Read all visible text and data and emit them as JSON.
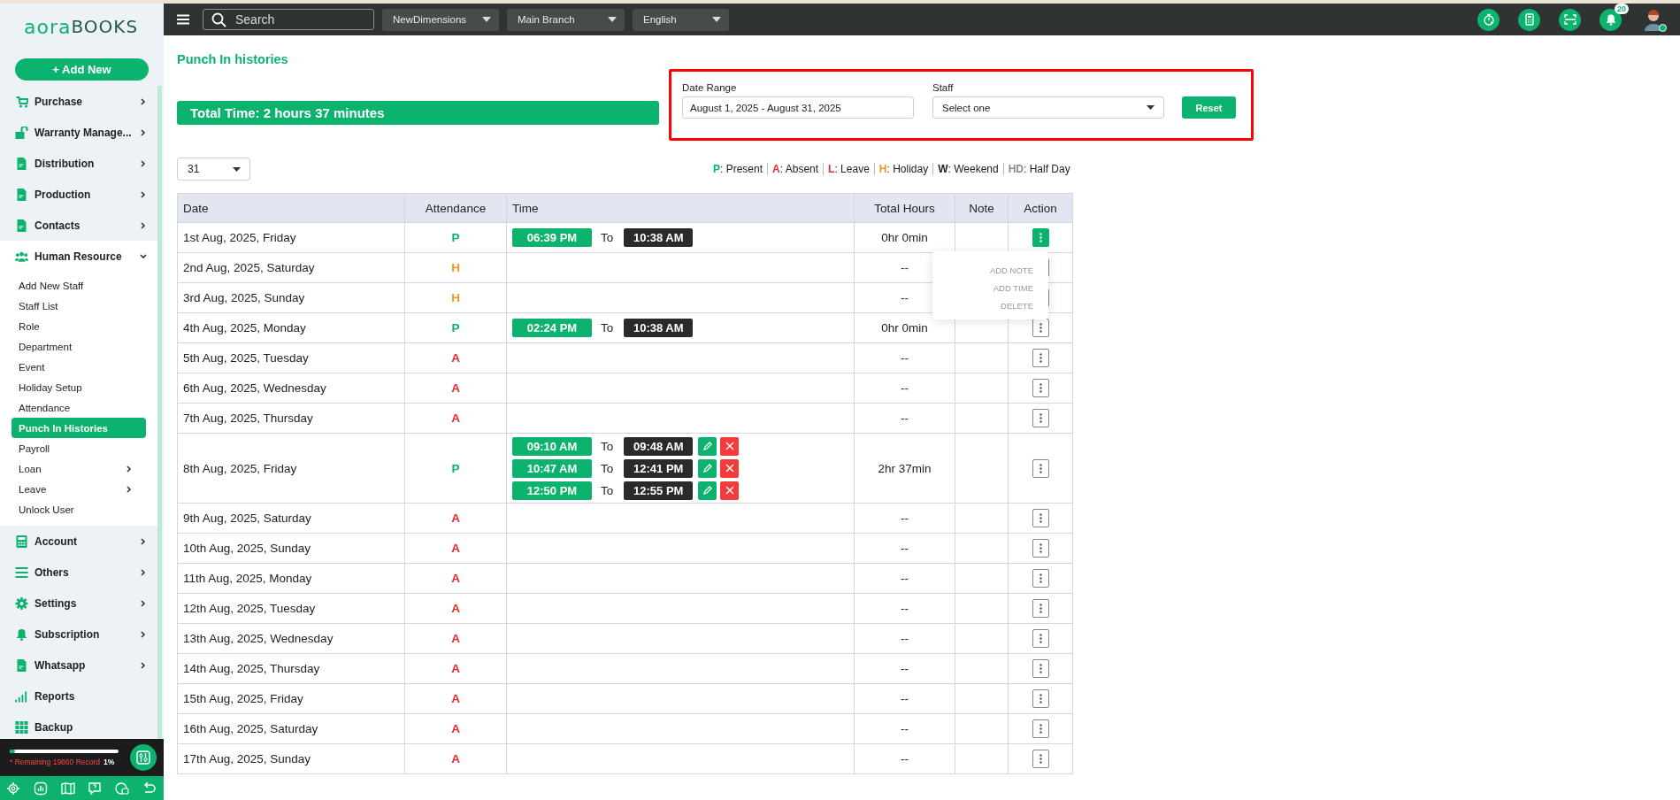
{
  "sidebar": {
    "logo": {
      "part_1": "aora",
      "part_2": "BOOKS"
    },
    "add_button": "+ Add New",
    "menu": [
      {
        "label": "Purchase",
        "kind": "group",
        "expanded": false
      },
      {
        "label": "Warranty Manage...",
        "kind": "group",
        "expanded": false
      },
      {
        "label": "Distribution",
        "kind": "group",
        "expanded": false
      },
      {
        "label": "Production",
        "kind": "group",
        "expanded": false
      },
      {
        "label": "Contacts",
        "kind": "group",
        "expanded": false
      },
      {
        "label": "Human Resource",
        "kind": "group",
        "expanded": true,
        "children": [
          {
            "label": "Add New Staff",
            "kind": "link",
            "selected": false
          },
          {
            "label": "Staff List",
            "kind": "link",
            "selected": false
          },
          {
            "label": "Role",
            "kind": "link",
            "selected": false
          },
          {
            "label": "Department",
            "kind": "link",
            "selected": false
          },
          {
            "label": "Event",
            "kind": "link",
            "selected": false
          },
          {
            "label": "Holiday Setup",
            "kind": "link",
            "selected": false
          },
          {
            "label": "Attendance",
            "kind": "link",
            "selected": false
          },
          {
            "label": "Punch In Histories",
            "kind": "link",
            "selected": true
          },
          {
            "label": "Payroll",
            "kind": "link",
            "selected": false
          },
          {
            "label": "Loan",
            "kind": "group",
            "selected": false
          },
          {
            "label": "Leave",
            "kind": "group",
            "selected": false
          },
          {
            "label": "Unlock User",
            "kind": "link",
            "selected": false
          }
        ]
      },
      {
        "label": "Account",
        "kind": "group",
        "expanded": false
      },
      {
        "label": "Others",
        "kind": "group",
        "expanded": false
      },
      {
        "label": "Settings",
        "kind": "group",
        "expanded": false
      },
      {
        "label": "Subscription",
        "kind": "group",
        "expanded": false
      },
      {
        "label": "Whatsapp",
        "kind": "group",
        "expanded": false
      },
      {
        "label": "Reports",
        "kind": "link"
      },
      {
        "label": "Backup",
        "kind": "link"
      }
    ],
    "usage": {
      "text": "* Remaining 19860 Record",
      "percent": "1%",
      "level": 0.05
    }
  },
  "topbar": {
    "search": {
      "placeholder": "Search"
    },
    "dropdowns": [
      "NewDimensions",
      "Main Branch",
      "English"
    ],
    "notification_count": "20"
  },
  "page": {
    "title": "Punch In histories",
    "total_time": "Total Time: 2 hours 37 minutes",
    "filters": {
      "date_range": {
        "label": "Date Range",
        "value": "August 1, 2025 - August 31, 2025"
      },
      "staff": {
        "label": "Staff",
        "placeholder": "Select one"
      },
      "reset": "Reset"
    },
    "page_size": "31",
    "legend": [
      {
        "code": "P",
        "label": ": Present",
        "color": "#0cb36f"
      },
      {
        "code": "A",
        "label": ": Absent",
        "color": "#f0282d"
      },
      {
        "code": "L",
        "label": ": Leave",
        "color": "#f0282d"
      },
      {
        "code": "H",
        "label": ": Holiday",
        "color": "#f5961e"
      },
      {
        "code": "W",
        "label": ": Weekend",
        "color": "#222222"
      },
      {
        "code": "HD",
        "label": ": Half Day",
        "color": "#8a8a8a"
      }
    ],
    "table": {
      "columns": [
        "Date",
        "Attendance",
        "Time",
        "Total Hours",
        "Note",
        "Action"
      ],
      "rows": [
        {
          "date": "1st Aug, 2025, Friday",
          "attendance": "P",
          "color": "#0cb36f",
          "punches": [
            {
              "in": "06:39 PM",
              "to": "To",
              "out": "10:38 AM",
              "editable": false
            }
          ],
          "total": "0hr 0min",
          "menu_open": true
        },
        {
          "date": "2nd Aug, 2025, Saturday",
          "attendance": "H",
          "color": "#f5961e",
          "punches": [],
          "total": "--",
          "menu_open": false
        },
        {
          "date": "3rd Aug, 2025, Sunday",
          "attendance": "H",
          "color": "#f5961e",
          "punches": [],
          "total": "--",
          "menu_open": false
        },
        {
          "date": "4th Aug, 2025, Monday",
          "attendance": "P",
          "color": "#0cb36f",
          "punches": [
            {
              "in": "02:24 PM",
              "to": "To",
              "out": "10:38 AM",
              "editable": false
            }
          ],
          "total": "0hr 0min",
          "menu_open": false
        },
        {
          "date": "5th Aug, 2025, Tuesday",
          "attendance": "A",
          "color": "#f0282d",
          "punches": [],
          "total": "--",
          "menu_open": false
        },
        {
          "date": "6th Aug, 2025, Wednesday",
          "attendance": "A",
          "color": "#f0282d",
          "punches": [],
          "total": "--",
          "menu_open": false
        },
        {
          "date": "7th Aug, 2025, Thursday",
          "attendance": "A",
          "color": "#f0282d",
          "punches": [],
          "total": "--",
          "menu_open": false
        },
        {
          "date": "8th Aug, 2025, Friday",
          "attendance": "P",
          "color": "#0cb36f",
          "punches": [
            {
              "in": "09:10 AM",
              "to": "To",
              "out": "09:48 AM",
              "editable": true
            },
            {
              "in": "10:47 AM",
              "to": "To",
              "out": "12:41 PM",
              "editable": true
            },
            {
              "in": "12:50 PM",
              "to": "To",
              "out": "12:55 PM",
              "editable": true
            }
          ],
          "total": "2hr 37min",
          "menu_open": false
        },
        {
          "date": "9th Aug, 2025, Saturday",
          "attendance": "A",
          "color": "#f0282d",
          "punches": [],
          "total": "--",
          "menu_open": false
        },
        {
          "date": "10th Aug, 2025, Sunday",
          "attendance": "A",
          "color": "#f0282d",
          "punches": [],
          "total": "--",
          "menu_open": false
        },
        {
          "date": "11th Aug, 2025, Monday",
          "attendance": "A",
          "color": "#f0282d",
          "punches": [],
          "total": "--",
          "menu_open": false
        },
        {
          "date": "12th Aug, 2025, Tuesday",
          "attendance": "A",
          "color": "#f0282d",
          "punches": [],
          "total": "--",
          "menu_open": false
        },
        {
          "date": "13th Aug, 2025, Wednesday",
          "attendance": "A",
          "color": "#f0282d",
          "punches": [],
          "total": "--",
          "menu_open": false
        },
        {
          "date": "14th Aug, 2025, Thursday",
          "attendance": "A",
          "color": "#f0282d",
          "punches": [],
          "total": "--",
          "menu_open": false
        },
        {
          "date": "15th Aug, 2025, Friday",
          "attendance": "A",
          "color": "#f0282d",
          "punches": [],
          "total": "--",
          "menu_open": false
        },
        {
          "date": "16th Aug, 2025, Saturday",
          "attendance": "A",
          "color": "#f0282d",
          "punches": [],
          "total": "--",
          "menu_open": false
        },
        {
          "date": "17th Aug, 2025, Sunday",
          "attendance": "A",
          "color": "#f0282d",
          "punches": [],
          "total": "--",
          "menu_open": false
        }
      ]
    },
    "action_menu": [
      "ADD NOTE",
      "ADD TIME",
      "DELETE"
    ]
  }
}
